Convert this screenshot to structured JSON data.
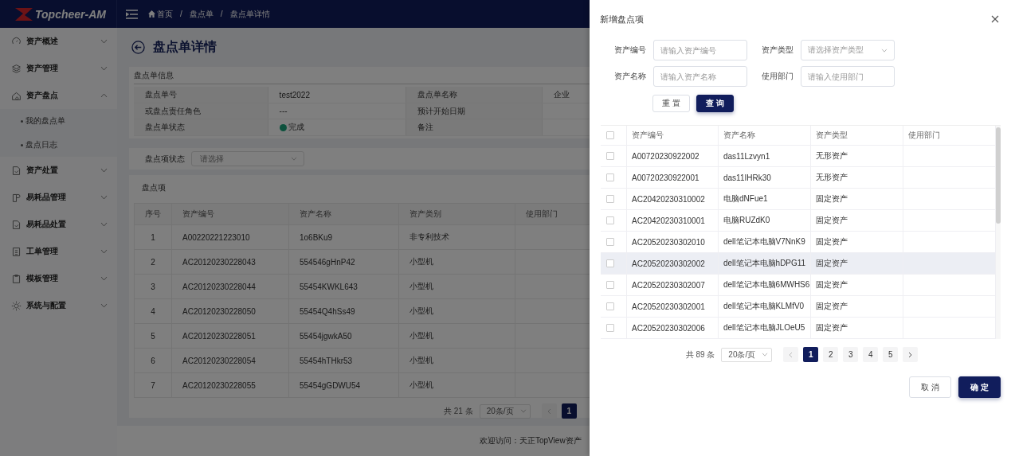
{
  "header": {
    "logo": "Topcheer-AM",
    "breadcrumb": [
      {
        "label": "首页"
      },
      {
        "label": "盘点单",
        "separator": "/"
      },
      {
        "label": "盘点单详情",
        "separator": "/"
      }
    ]
  },
  "sidebar": {
    "items": [
      {
        "label": "资产概述",
        "expanded": false
      },
      {
        "label": "资产管理",
        "expanded": false
      },
      {
        "label": "资产盘点",
        "expanded": true,
        "children": [
          {
            "label": "我的盘点单"
          },
          {
            "label": "盘点日志"
          }
        ]
      },
      {
        "label": "资产处置",
        "expanded": false
      },
      {
        "label": "易耗品管理",
        "expanded": false
      },
      {
        "label": "易耗品处置",
        "expanded": false
      },
      {
        "label": "工单管理",
        "expanded": false
      },
      {
        "label": "模板管理",
        "expanded": false
      },
      {
        "label": "系统与配置",
        "expanded": false
      }
    ]
  },
  "page": {
    "title": "盘点单详情",
    "info": {
      "title": "盘点单信息",
      "rows": [
        {
          "label": "盘点单号",
          "value": "test2022",
          "label_2": "盘点单名称",
          "value_2": "企业"
        },
        {
          "label": "或盘点责任角色",
          "value": "---",
          "label_2": "预计开始日期"
        },
        {
          "label": "盘点单状态",
          "status": {
            "text": "完成"
          },
          "label_2": "备注"
        }
      ]
    },
    "filter": {
      "label": "盘点项状态",
      "placeholder": "请选择"
    },
    "items": {
      "title": "盘点项",
      "columns": [
        "序号",
        "资产编号",
        "资产名称",
        "资产类别",
        "使用部门"
      ],
      "rows": [
        [
          "1",
          "A00220221223010",
          "1o6BKu9",
          "非专利技术"
        ],
        [
          "2",
          "AC20120230228043",
          "554546gHnP42",
          "小型机"
        ],
        [
          "3",
          "AC20120230228044",
          "55454KWKL643",
          "小型机"
        ],
        [
          "4",
          "AC20120230228050",
          "55454Q4hSs49",
          "小型机"
        ],
        [
          "5",
          "AC20120230228051",
          "55454jgwkA50",
          "小型机"
        ],
        [
          "6",
          "AC20120230228054",
          "55454hTHkr53",
          "小型机"
        ],
        [
          "7",
          "AC20120230228055",
          "55454gGDWU54",
          "小型机"
        ]
      ],
      "pager": {
        "total": "共 21 条",
        "page_size": "20条/页",
        "pages": [
          {
            "label": "1",
            "selected": true
          }
        ]
      }
    },
    "footer": "欢迎访问：天正TopView资产"
  },
  "drawer": {
    "title": "新增盘点项",
    "fields": [
      {
        "label": "资产编号",
        "placeholder": "请输入资产编号",
        "kind": "input"
      },
      {
        "label": "资产类型",
        "placeholder": "请选择资产类型",
        "kind": "select"
      },
      {
        "label": "资产名称",
        "placeholder": "请输入资产名称",
        "kind": "input"
      },
      {
        "label": "使用部门",
        "placeholder": "请输入使用部门",
        "kind": "input"
      }
    ],
    "reset": "重 置",
    "query": "查 询",
    "table": {
      "all_checked": false,
      "columns": [
        "资产编号",
        "资产名称",
        "资产类型",
        "使用部门"
      ],
      "rows": [
        {
          "code": "A00720230922002",
          "name": "das11Lzvyn1",
          "type": "无形资产",
          "checked": false,
          "highlighted": false
        },
        {
          "code": "A00720230922001",
          "name": "das11IHRk30",
          "type": "无形资产",
          "checked": false,
          "highlighted": false
        },
        {
          "code": "AC20420230310002",
          "name": "电脑dNFue1",
          "type": "固定资产",
          "checked": false,
          "highlighted": false
        },
        {
          "code": "AC20420230310001",
          "name": "电脑RUZdK0",
          "type": "固定资产",
          "checked": false,
          "highlighted": false
        },
        {
          "code": "AC20520230302010",
          "name": "dell笔记本电脑V7NnK9",
          "type": "固定资产",
          "checked": false,
          "highlighted": false
        },
        {
          "code": "AC20520230302002",
          "name": "dell笔记本电脑hDPG11",
          "type": "固定资产",
          "checked": false,
          "highlighted": true
        },
        {
          "code": "AC20520230302007",
          "name": "dell笔记本电脑6MWHS6",
          "type": "固定资产",
          "checked": false,
          "highlighted": false
        },
        {
          "code": "AC20520230302001",
          "name": "dell笔记本电脑KLMfV0",
          "type": "固定资产",
          "checked": false,
          "highlighted": false
        },
        {
          "code": "AC20520230302006",
          "name": "dell笔记本电脑JLOeU5",
          "type": "固定资产",
          "checked": false,
          "highlighted": false
        }
      ]
    },
    "pager": {
      "total": "共 89 条",
      "page_size": "20条/页",
      "pages": [
        {
          "label": "1",
          "selected": true
        },
        {
          "label": "2",
          "selected": false
        },
        {
          "label": "3",
          "selected": false
        },
        {
          "label": "4",
          "selected": false
        },
        {
          "label": "5",
          "selected": false
        }
      ]
    },
    "cancel": "取 消",
    "confirm": "确 定"
  }
}
